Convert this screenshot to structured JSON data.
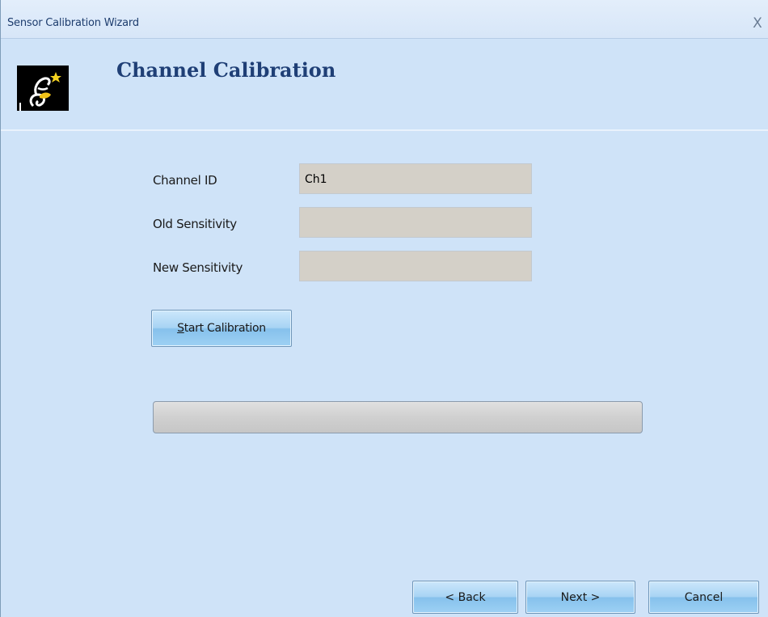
{
  "window": {
    "title": "Sensor Calibration Wizard",
    "close_glyph": "X"
  },
  "header": {
    "title": "Channel Calibration",
    "logo_icon": "wizard-logo-icon"
  },
  "form": {
    "channel_id": {
      "label": "Channel ID",
      "value": "Ch1"
    },
    "old_sensitivity": {
      "label": "Old Sensitivity",
      "value": ""
    },
    "new_sensitivity": {
      "label": "New Sensitivity",
      "value": ""
    }
  },
  "start_button": {
    "mnemonic": "S",
    "rest": "tart Calibration"
  },
  "progress": {
    "fraction": 0
  },
  "nav": {
    "back_label": "< Back",
    "next_label": "Next >",
    "cancel_label": "Cancel"
  },
  "colors": {
    "background": "#cfe3f8",
    "title_text": "#1f3f76",
    "field_bg": "#d4d0c8",
    "button_blue": "#a8d4f4"
  }
}
